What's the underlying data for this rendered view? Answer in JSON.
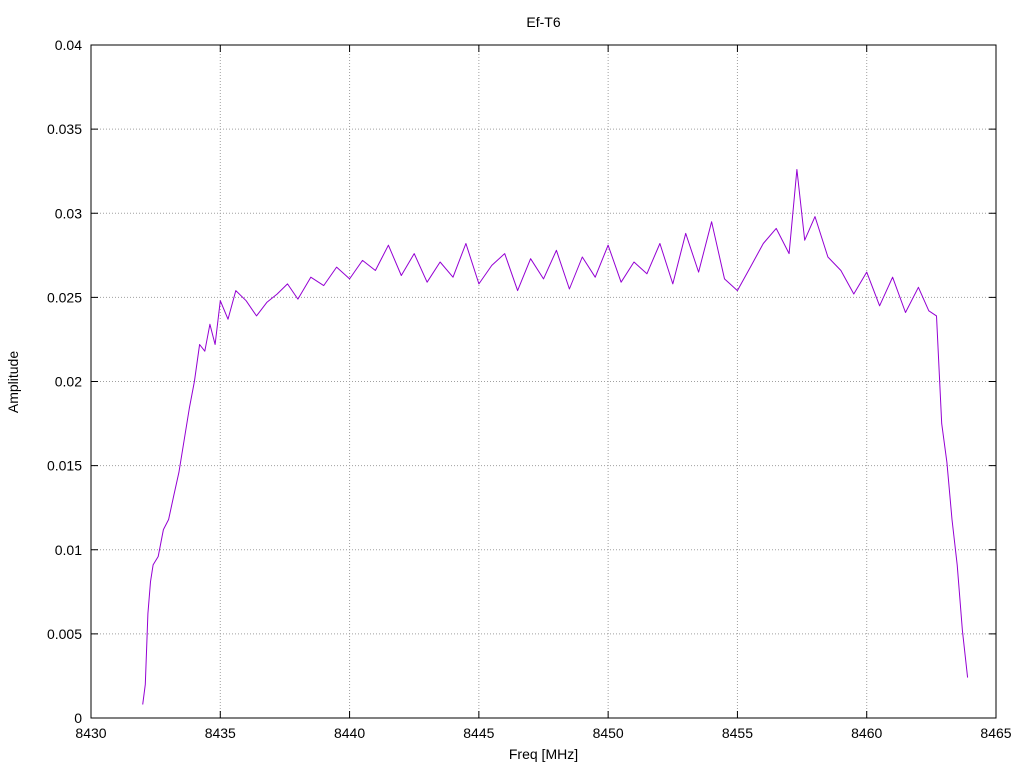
{
  "chart_data": {
    "type": "line",
    "title": "Ef-T6",
    "xlabel": "Freq [MHz]",
    "ylabel": "Amplitude",
    "xlim": [
      8430,
      8465
    ],
    "ylim": [
      0,
      0.04
    ],
    "x_ticks": [
      8430,
      8435,
      8440,
      8445,
      8450,
      8455,
      8460,
      8465
    ],
    "y_ticks": [
      0,
      0.005,
      0.01,
      0.015,
      0.02,
      0.025,
      0.03,
      0.035,
      0.04
    ],
    "y_tick_labels": [
      "0",
      "0.005",
      "0.01",
      "0.015",
      "0.02",
      "0.025",
      "0.03",
      "0.035",
      "0.04"
    ],
    "grid": true,
    "legend": "none",
    "series_color": "#9400d3",
    "series": [
      {
        "x": [
          8432.0,
          8432.1,
          8432.2,
          8432.3,
          8432.4,
          8432.6,
          8432.8,
          8433.0,
          8433.2,
          8433.4,
          8433.6,
          8433.8,
          8434.0,
          8434.2,
          8434.4,
          8434.6,
          8434.8,
          8435.0,
          8435.3,
          8435.6,
          8436.0,
          8436.4,
          8436.8,
          8437.2,
          8437.6,
          8438.0,
          8438.5,
          8439.0,
          8439.5,
          8440.0,
          8440.5,
          8441.0,
          8441.5,
          8442.0,
          8442.5,
          8443.0,
          8443.5,
          8444.0,
          8444.5,
          8445.0,
          8445.5,
          8446.0,
          8446.5,
          8447.0,
          8447.5,
          8448.0,
          8448.5,
          8449.0,
          8449.5,
          8450.0,
          8450.5,
          8451.0,
          8451.5,
          8452.0,
          8452.5,
          8453.0,
          8453.5,
          8454.0,
          8454.5,
          8455.0,
          8455.5,
          8456.0,
          8456.5,
          8457.0,
          8457.3,
          8457.6,
          8458.0,
          8458.5,
          8459.0,
          8459.5,
          8460.0,
          8460.5,
          8461.0,
          8461.5,
          8462.0,
          8462.4,
          8462.7,
          8462.9,
          8463.1,
          8463.3,
          8463.5,
          8463.7,
          8463.9
        ],
        "y": [
          0.0008,
          0.002,
          0.0062,
          0.0081,
          0.0091,
          0.0096,
          0.0112,
          0.0118,
          0.0132,
          0.0146,
          0.0165,
          0.0184,
          0.02,
          0.0222,
          0.0218,
          0.0234,
          0.0222,
          0.0248,
          0.0237,
          0.0254,
          0.0248,
          0.0239,
          0.0247,
          0.0252,
          0.0258,
          0.0249,
          0.0262,
          0.0257,
          0.0268,
          0.0261,
          0.0272,
          0.0266,
          0.0281,
          0.0263,
          0.0276,
          0.0259,
          0.0271,
          0.0262,
          0.0282,
          0.0258,
          0.0269,
          0.0276,
          0.0254,
          0.0273,
          0.0261,
          0.0278,
          0.0255,
          0.0274,
          0.0262,
          0.0281,
          0.0259,
          0.0271,
          0.0264,
          0.0282,
          0.0258,
          0.0288,
          0.0265,
          0.0295,
          0.0261,
          0.0254,
          0.0268,
          0.0282,
          0.0291,
          0.0276,
          0.0326,
          0.0284,
          0.0298,
          0.0274,
          0.0266,
          0.0252,
          0.0265,
          0.0245,
          0.0262,
          0.0241,
          0.0256,
          0.0242,
          0.0239,
          0.0175,
          0.0152,
          0.0118,
          0.0091,
          0.0052,
          0.0024
        ]
      }
    ]
  }
}
